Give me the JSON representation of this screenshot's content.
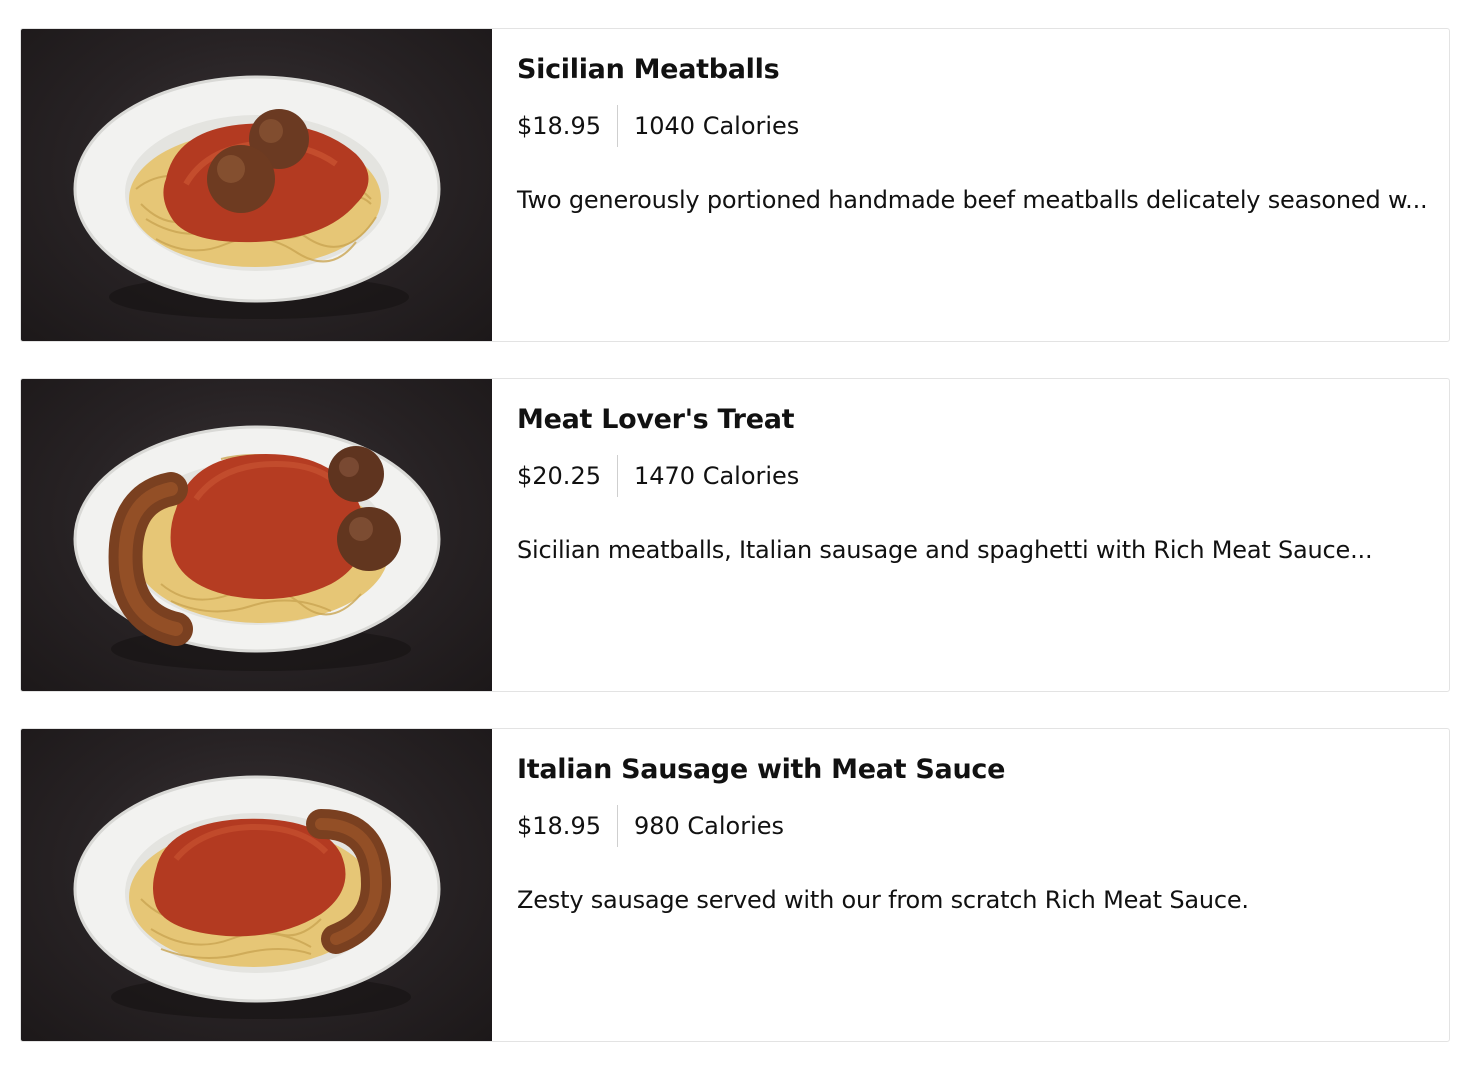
{
  "menu_items": [
    {
      "name": "Sicilian Meatballs",
      "price": "$18.95",
      "calories": "1040 Calories",
      "description": "Two generously portioned handmade beef meatballs delicately seasoned w...",
      "image_icon": "spaghetti-meatballs-photo"
    },
    {
      "name": "Meat Lover's Treat",
      "price": "$20.25",
      "calories": "1470 Calories",
      "description": "Sicilian meatballs, Italian sausage and spaghetti with Rich Meat Sauce...",
      "image_icon": "spaghetti-sausage-meatballs-photo"
    },
    {
      "name": "Italian Sausage with Meat Sauce",
      "price": "$18.95",
      "calories": "980 Calories",
      "description": "Zesty sausage served with our from scratch Rich Meat Sauce.",
      "image_icon": "spaghetti-sausage-photo"
    }
  ],
  "colors": {
    "card_border": "#e3e3e3",
    "photo_background": "#272224",
    "text": "#111111",
    "sauce": "#b23a22",
    "pasta": "#e8c97a",
    "plate": "#f2f2f0"
  }
}
